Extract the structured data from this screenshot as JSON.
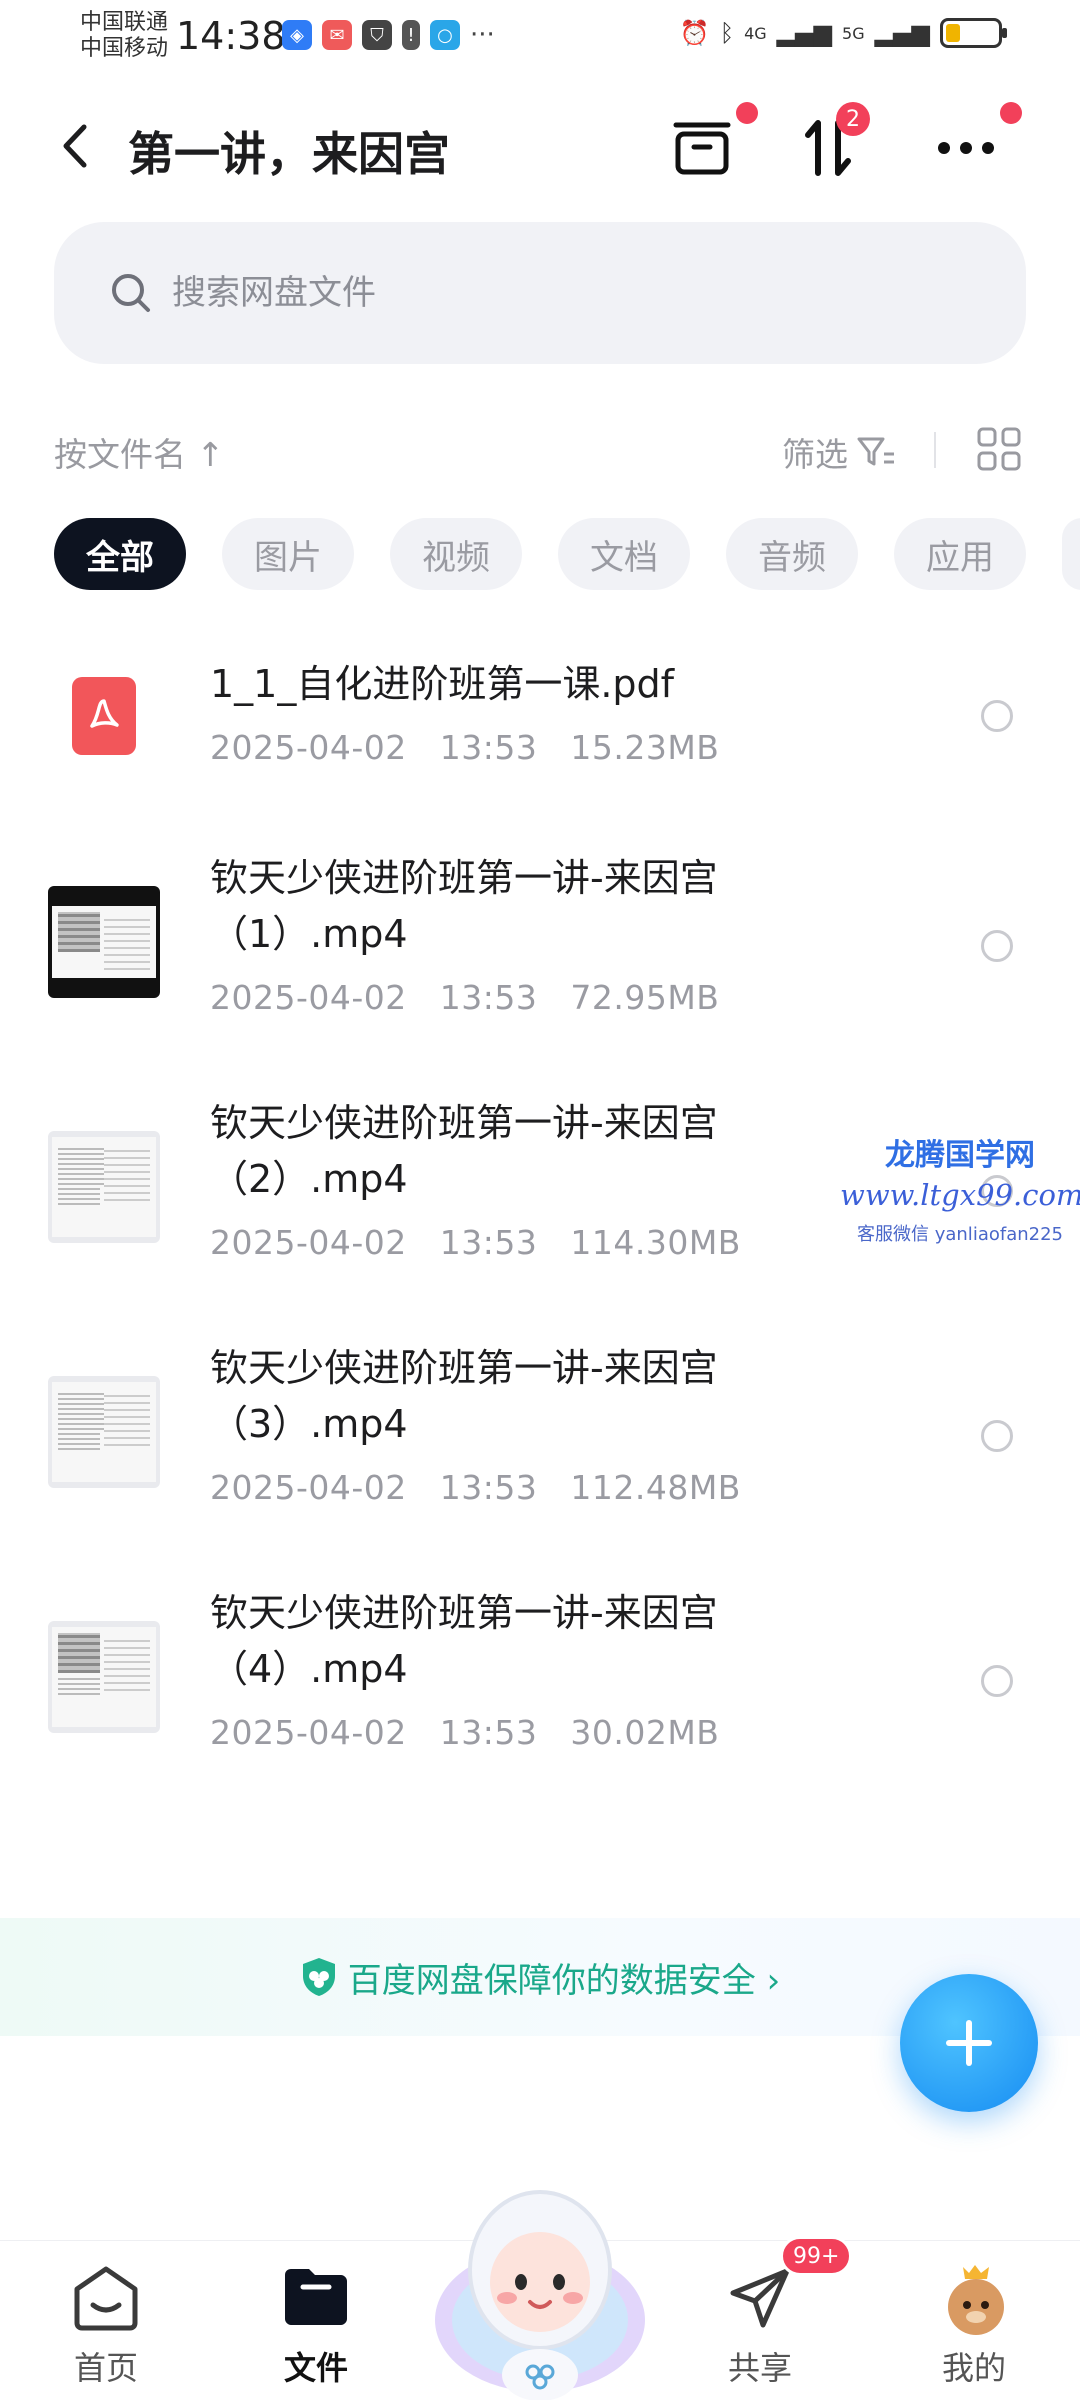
{
  "status_bar": {
    "carrier1": "中国联通",
    "carrier2": "中国移动",
    "time": "14:38",
    "signal1": "4G",
    "signal2": "5G"
  },
  "header": {
    "title": "第一讲，来因宫",
    "transfer_badge": "2"
  },
  "search": {
    "placeholder": "搜索网盘文件"
  },
  "sort": {
    "label": "按文件名 ↑",
    "filter_label": "筛选"
  },
  "tabs": [
    {
      "label": "全部",
      "active": true
    },
    {
      "label": "图片"
    },
    {
      "label": "视频"
    },
    {
      "label": "文档"
    },
    {
      "label": "音频"
    },
    {
      "label": "应用"
    }
  ],
  "files": [
    {
      "name": "1_1_自化进阶班第一课.pdf",
      "date": "2025-04-02",
      "time": "13:53",
      "size": "15.23MB",
      "type": "pdf"
    },
    {
      "name": "钦天少侠进阶班第一讲-来因宫（1）.mp4",
      "date": "2025-04-02",
      "time": "13:53",
      "size": "72.95MB",
      "type": "video"
    },
    {
      "name": "钦天少侠进阶班第一讲-来因宫（2）.mp4",
      "date": "2025-04-02",
      "time": "13:53",
      "size": "114.30MB",
      "type": "video"
    },
    {
      "name": "钦天少侠进阶班第一讲-来因宫（3）.mp4",
      "date": "2025-04-02",
      "time": "13:53",
      "size": "112.48MB",
      "type": "video"
    },
    {
      "name": "钦天少侠进阶班第一讲-来因宫（4）.mp4",
      "date": "2025-04-02",
      "time": "13:53",
      "size": "30.02MB",
      "type": "video"
    }
  ],
  "watermark": {
    "title": "龙腾国学网",
    "url": "www.ltgx99.com",
    "contact": "客服微信 yanliaofan225"
  },
  "security_banner": {
    "text": "百度网盘保障你的数据安全 ›"
  },
  "bottom_nav": {
    "home": "首页",
    "files": "文件",
    "share": "共享",
    "share_badge": "99+",
    "mine": "我的"
  },
  "colors": {
    "accent_blue": "#168cf2",
    "badge_red": "#f2405a",
    "security_green": "#1aa88a",
    "chip_active": "#0d1320"
  }
}
